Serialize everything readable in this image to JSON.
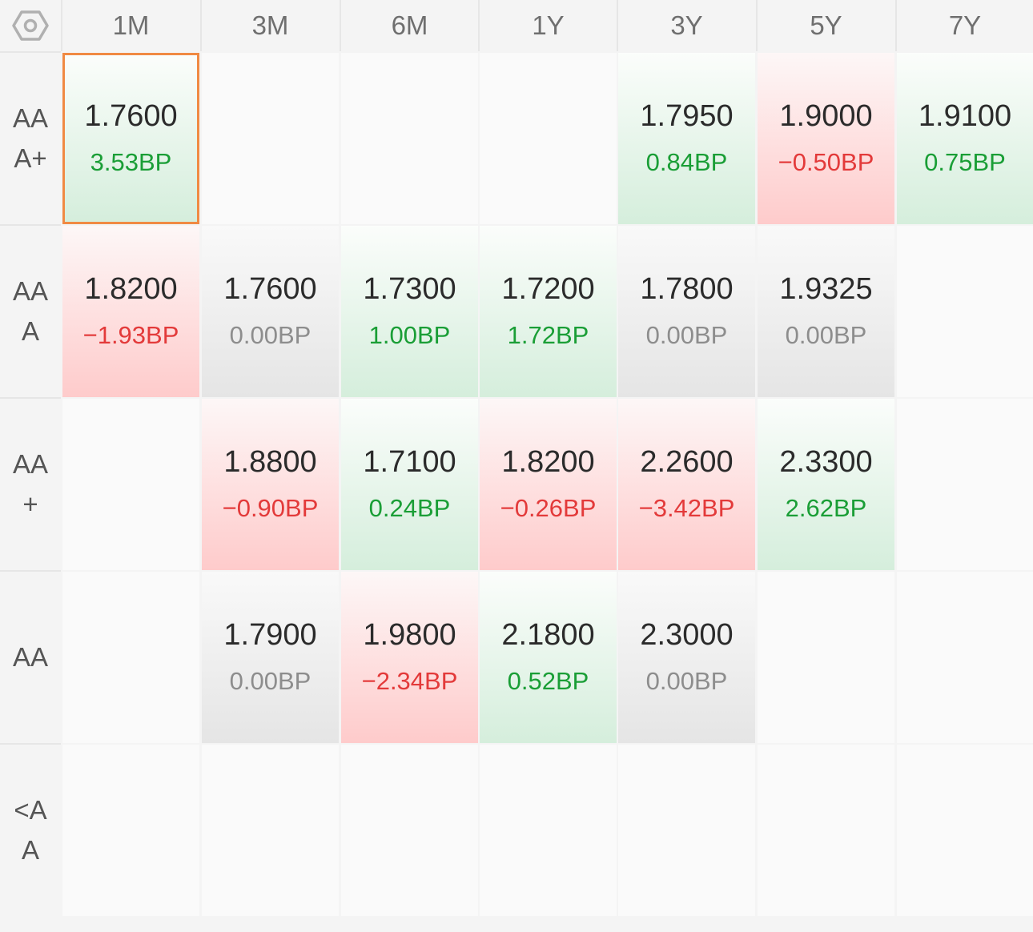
{
  "corner": {
    "icon": "settings-hex-icon"
  },
  "columns": [
    "1M",
    "3M",
    "6M",
    "1Y",
    "3Y",
    "5Y",
    "7Y"
  ],
  "rows": [
    {
      "label": "AA\nA+",
      "cells": [
        {
          "value": "1.7600",
          "change": "3.53BP",
          "dir": "up",
          "selected": true
        },
        null,
        null,
        null,
        {
          "value": "1.7950",
          "change": "0.84BP",
          "dir": "up"
        },
        {
          "value": "1.9000",
          "change": "−0.50BP",
          "dir": "down"
        },
        {
          "value": "1.9100",
          "change": "0.75BP",
          "dir": "up"
        }
      ]
    },
    {
      "label": "AA\nA",
      "cells": [
        {
          "value": "1.8200",
          "change": "−1.93BP",
          "dir": "down"
        },
        {
          "value": "1.7600",
          "change": "0.00BP",
          "dir": "flat"
        },
        {
          "value": "1.7300",
          "change": "1.00BP",
          "dir": "up"
        },
        {
          "value": "1.7200",
          "change": "1.72BP",
          "dir": "up"
        },
        {
          "value": "1.7800",
          "change": "0.00BP",
          "dir": "flat"
        },
        {
          "value": "1.9325",
          "change": "0.00BP",
          "dir": "flat"
        },
        null
      ]
    },
    {
      "label": "AA\n+",
      "cells": [
        null,
        {
          "value": "1.8800",
          "change": "−0.90BP",
          "dir": "down"
        },
        {
          "value": "1.7100",
          "change": "0.24BP",
          "dir": "up"
        },
        {
          "value": "1.8200",
          "change": "−0.26BP",
          "dir": "down"
        },
        {
          "value": "2.2600",
          "change": "−3.42BP",
          "dir": "down"
        },
        {
          "value": "2.3300",
          "change": "2.62BP",
          "dir": "up"
        },
        null
      ]
    },
    {
      "label": "AA",
      "cells": [
        null,
        {
          "value": "1.7900",
          "change": "0.00BP",
          "dir": "flat"
        },
        {
          "value": "1.9800",
          "change": "−2.34BP",
          "dir": "down"
        },
        {
          "value": "2.1800",
          "change": "0.52BP",
          "dir": "up"
        },
        {
          "value": "2.3000",
          "change": "0.00BP",
          "dir": "flat"
        },
        null,
        null
      ]
    },
    {
      "label": "<A\nA",
      "cells": [
        null,
        null,
        null,
        null,
        null,
        null,
        null
      ]
    }
  ],
  "colors": {
    "up": "#1a9e36",
    "down": "#e33a3a",
    "flat": "#8d8d8d",
    "selected_border": "#f08a43"
  }
}
